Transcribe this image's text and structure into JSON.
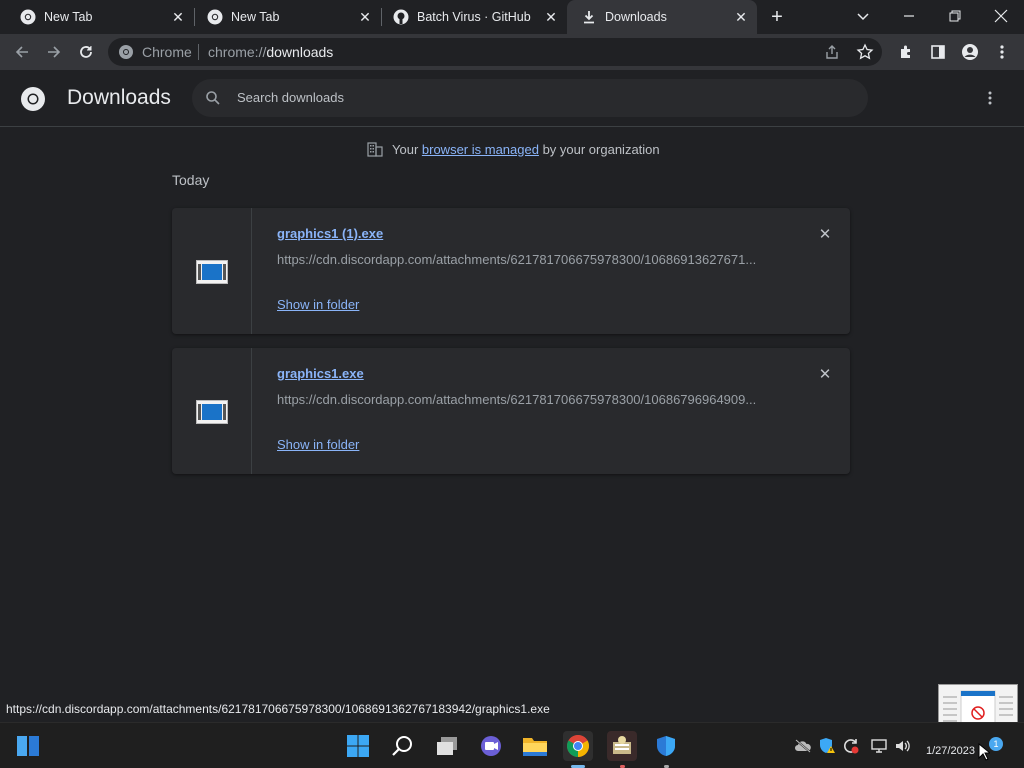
{
  "tabs": [
    {
      "title": "New Tab",
      "icon": "chrome-icon"
    },
    {
      "title": "New Tab",
      "icon": "chrome-icon"
    },
    {
      "title": "Batch Virus · GitHub",
      "icon": "github-icon"
    },
    {
      "title": "Downloads",
      "icon": "download-icon",
      "active": true
    }
  ],
  "omnibox": {
    "chip": "Chrome",
    "scheme": "chrome://",
    "path": "downloads"
  },
  "downloads_page": {
    "title": "Downloads",
    "search_placeholder": "Search downloads",
    "managed_prefix": "Your ",
    "managed_link": "browser is managed",
    "managed_suffix": " by your organization",
    "section_label": "Today",
    "items": [
      {
        "file_name": "graphics1 (1).exe",
        "url": "https://cdn.discordapp.com/attachments/621781706675978300/10686913627671...",
        "action": "Show in folder"
      },
      {
        "file_name": "graphics1.exe",
        "url": "https://cdn.discordapp.com/attachments/621781706675978300/10686796964909...",
        "action": "Show in folder"
      }
    ]
  },
  "status_bar": {
    "url": "https://cdn.discordapp.com/attachments/621781706675978300/1068691362767183942/graphics1.exe"
  },
  "taskbar": {
    "clock": "1/27/2023",
    "notification_count": "1"
  },
  "colors": {
    "accent": "#8ab4f8",
    "background": "#202124",
    "card": "#292a2d",
    "toolbar": "#35363a"
  }
}
